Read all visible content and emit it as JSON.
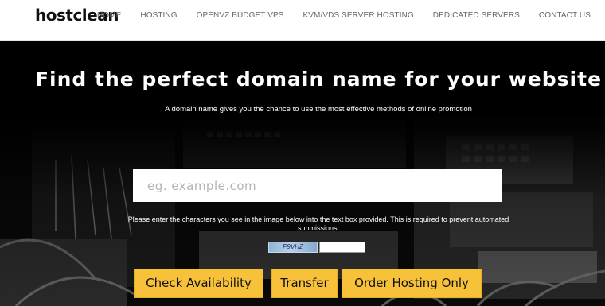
{
  "header": {
    "logo": "hostclean",
    "nav": [
      {
        "label": "HOME"
      },
      {
        "label": "HOSTING"
      },
      {
        "label": "OPENVZ BUDGET VPS"
      },
      {
        "label": "KVM/VDS SERVER HOSTING"
      },
      {
        "label": "DEDICATED SERVERS"
      },
      {
        "label": "CONTACT US"
      }
    ]
  },
  "hero": {
    "headline": "Find the perfect domain name for your website",
    "subheadline": "A domain name gives you the chance to use the most effective methods of online promotion",
    "search_placeholder": "eg. example.com",
    "captcha_note": "Please enter the characters you see in the image below into the text box provided. This is required to prevent automated submissions.",
    "captcha_code": "P9VHZ",
    "captcha_value": "",
    "buttons": {
      "check": "Check Availability",
      "transfer": "Transfer",
      "order": "Order Hosting Only"
    }
  },
  "colors": {
    "button_bg": "#f7c23a",
    "header_bg": "#ffffff",
    "hero_bg": "#000000"
  }
}
